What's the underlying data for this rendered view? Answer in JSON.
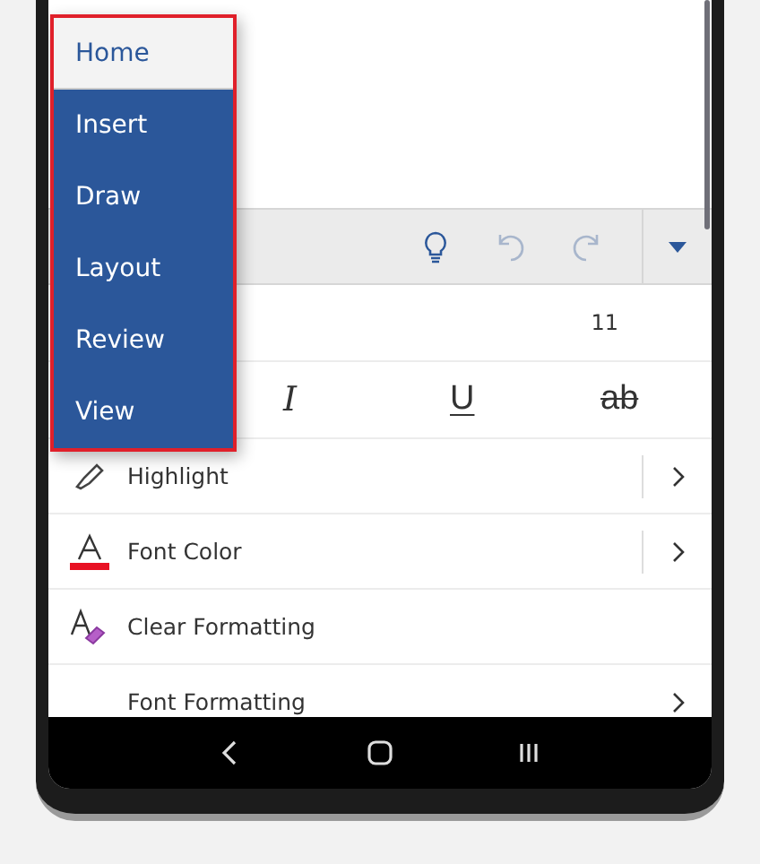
{
  "tab_menu": {
    "items": [
      {
        "label": "Home",
        "selected": true
      },
      {
        "label": "Insert",
        "selected": false
      },
      {
        "label": "Draw",
        "selected": false
      },
      {
        "label": "Layout",
        "selected": false
      },
      {
        "label": "Review",
        "selected": false
      },
      {
        "label": "View",
        "selected": false
      }
    ]
  },
  "font_size": "11",
  "format_buttons": [
    {
      "label": "I",
      "kind": "italic"
    },
    {
      "label": "U",
      "kind": "underline"
    },
    {
      "label": "ab",
      "kind": "strikethrough"
    }
  ],
  "options": [
    {
      "label": "Highlight",
      "kind": "highlight",
      "split": true,
      "submenu": true
    },
    {
      "label": "Font Color",
      "kind": "font-color",
      "split": true,
      "submenu": true
    },
    {
      "label": "Clear Formatting",
      "kind": "clear",
      "split": false,
      "submenu": false
    },
    {
      "label": "Font Formatting",
      "kind": "plain",
      "split": false,
      "submenu": true
    }
  ]
}
